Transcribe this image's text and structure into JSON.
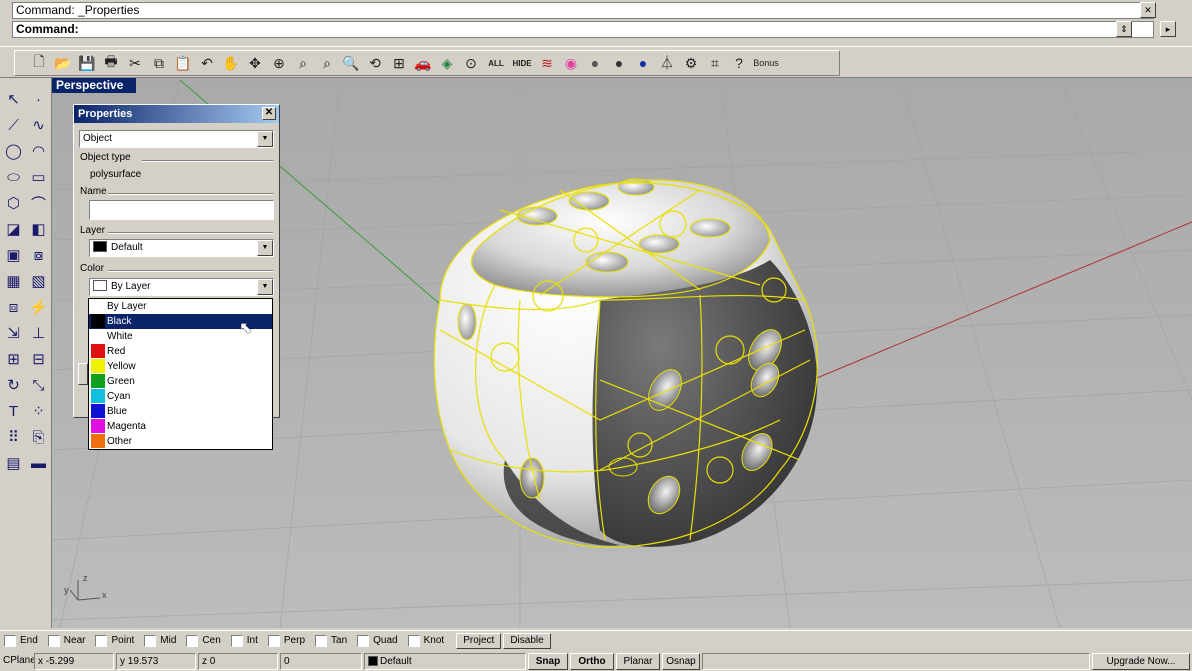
{
  "command": {
    "history": "Command: _Properties",
    "prompt": "Command:"
  },
  "toolbar": {
    "buttons": [
      "new-icon",
      "open-icon",
      "save-icon",
      "print-icon",
      "cut-icon",
      "copy-icon",
      "paste-icon",
      "undo-icon",
      "pan-icon",
      "rotate-view-icon",
      "zoom-dynamic-icon",
      "zoom-window-icon",
      "zoom-selected-icon",
      "zoom-extents-icon",
      "zoom-all-icon",
      "four-viewports-icon",
      "car-icon",
      "layer-icon",
      "point-icon"
    ],
    "all_label": "ALL",
    "hide_label": "HIDE",
    "bonus_label": "Bonus"
  },
  "viewport": {
    "title": "Perspective",
    "axis_x": "x",
    "axis_y": "y",
    "axis_z": "z"
  },
  "properties": {
    "title": "Properties",
    "page_select": "Object",
    "object_type_label": "Object type",
    "object_type_value": "polysurface",
    "name_label": "Name",
    "name_value": "",
    "layer_label": "Layer",
    "layer_value": "Default",
    "color_label": "Color",
    "color_value": "By Layer",
    "color_options": [
      {
        "label": "By Layer",
        "color": "#ffffff"
      },
      {
        "label": "Black",
        "color": "#000000",
        "selected": true
      },
      {
        "label": "White",
        "color": "#ffffff"
      },
      {
        "label": "Red",
        "color": "#e01010"
      },
      {
        "label": "Yellow",
        "color": "#f0f000"
      },
      {
        "label": "Green",
        "color": "#10a020"
      },
      {
        "label": "Cyan",
        "color": "#10c0e0"
      },
      {
        "label": "Blue",
        "color": "#1010d0"
      },
      {
        "label": "Magenta",
        "color": "#e010e0"
      },
      {
        "label": "Other",
        "color": "#f07010"
      }
    ]
  },
  "osnap": {
    "items": [
      "End",
      "Near",
      "Point",
      "Mid",
      "Cen",
      "Int",
      "Perp",
      "Tan",
      "Quad",
      "Knot"
    ],
    "project": "Project",
    "disable": "Disable"
  },
  "status": {
    "cplane": "CPlane",
    "x": "x -5.299",
    "y": "y 19.573",
    "z": "z 0",
    "extra": "0",
    "layer": "Default",
    "snap": "Snap",
    "ortho": "Ortho",
    "planar": "Planar",
    "osnap": "Osnap",
    "upgrade": "Upgrade Now..."
  },
  "colors": {
    "selection_blue": "#0a246a",
    "wireframe_yellow": "#e8e000",
    "viewport_gray": "#b0b0b0"
  }
}
